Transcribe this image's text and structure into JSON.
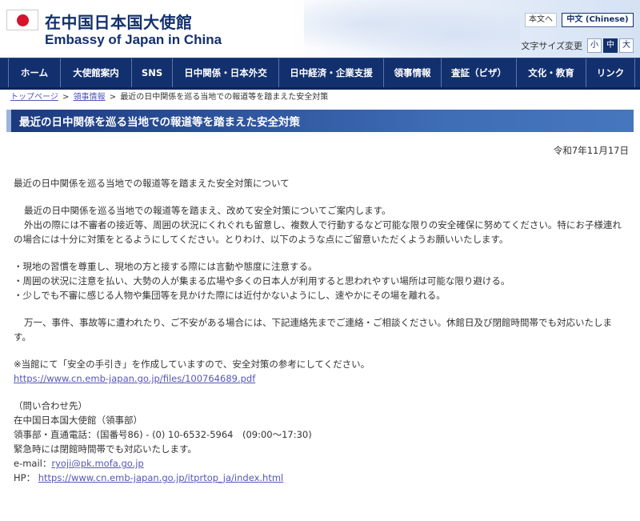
{
  "header": {
    "title_jp": "在中国日本国大使館",
    "title_en": "Embassy of Japan in China",
    "lang_jp": "本文へ",
    "lang_cn": "中文 (Chinese)",
    "font_size_label": "文字サイズ変更",
    "font_sizes": [
      "小",
      "中",
      "大"
    ],
    "font_size_selected": "中"
  },
  "nav": {
    "items": [
      "ホーム",
      "大使館案内",
      "SNS",
      "日中関係・日本外交",
      "日中経済・企業支援",
      "領事情報",
      "査証（ビザ）",
      "文化・教育",
      "リンク"
    ]
  },
  "breadcrumb": {
    "top": "トップページ",
    "consular": "領事情報",
    "current": "最近の日中関係を巡る当地での報道等を踏まえた安全対策"
  },
  "article": {
    "heading": "最近の日中関係を巡る当地での報道等を踏まえた安全対策",
    "date": "令和7年11月17日",
    "subject": "最近の日中関係を巡る当地での報道等を踏まえた安全対策について",
    "intro1": "最近の日中関係を巡る当地での報道等を踏まえ、改めて安全対策についてご案内します。",
    "intro2": "外出の際には不審者の接近等、周囲の状況にくれぐれも留意し、複数人で行動するなど可能な限りの安全確保に努めてください。特にお子様連れの場合には十分に対策をとるようにしてください。とりわけ、以下のような点にご留意いただくようお願いいたします。",
    "bullet1": "・現地の習慣を尊重し、現地の方と接する際には言動や態度に注意する。",
    "bullet2": "・周囲の状況に注意を払い、大勢の人が集まる広場や多くの日本人が利用すると思われやすい場所は可能な限り避ける。",
    "bullet3": "・少しでも不審に感じる人物や集団等を見かけた際には近付かないようにし、速やかにその場を離れる。",
    "emergency": "万一、事件、事故等に遭われたり、ご不安がある場合には、下記連絡先までご連絡・ご相談ください。休館日及び閉館時間帯でも対応いたします。",
    "guide_note": "※当館にて「安全の手引き」を作成していますので、安全対策の参考にしてください。",
    "guide_link": "https://www.cn.emb-japan.go.jp/files/100764689.pdf",
    "contact_head": "（問い合わせ先）",
    "contact_org": "在中国日本国大使館（領事部）",
    "contact_tel": "領事部・直通電話：(国番号86) - (0) 10-6532-5964　(09:00～17:30)",
    "contact_hours": "緊急時には閉館時間帯でも対応いたします。",
    "email_label": "e-mail：",
    "email": "ryoji@pk.mofa.go.jp",
    "hp_label": "HP：",
    "hp_link": "https://www.cn.emb-japan.go.jp/itprtop_ja/index.html"
  }
}
